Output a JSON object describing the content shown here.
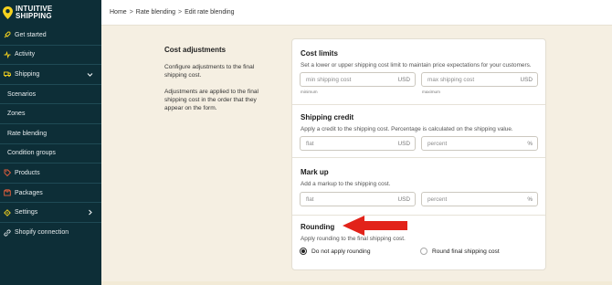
{
  "brand": {
    "line1": "INTUITIVE",
    "line2": "SHIPPING"
  },
  "sidebar": {
    "items": [
      {
        "label": "Get started",
        "icon": "rocket-icon"
      },
      {
        "label": "Activity",
        "icon": "activity-icon"
      },
      {
        "label": "Shipping",
        "icon": "truck-icon"
      },
      {
        "label": "Scenarios"
      },
      {
        "label": "Zones"
      },
      {
        "label": "Rate blending"
      },
      {
        "label": "Condition groups"
      },
      {
        "label": "Products",
        "icon": "tag-icon"
      },
      {
        "label": "Packages",
        "icon": "package-icon"
      },
      {
        "label": "Settings",
        "icon": "gear-icon"
      },
      {
        "label": "Shopify connection",
        "icon": "link-icon"
      }
    ]
  },
  "breadcrumb": {
    "home": "Home",
    "sep": ">",
    "rate_blending": "Rate blending",
    "current": "Edit rate blending"
  },
  "description": {
    "title": "Cost adjustments",
    "p1": "Configure adjustments to the final shipping cost.",
    "p2": "Adjustments are applied to the final shipping cost in the order that they appear on the form."
  },
  "cost_limits": {
    "title": "Cost limits",
    "help": "Set a lower or upper shipping cost limit to maintain price expectations for your customers.",
    "min_placeholder": "min shipping cost",
    "min_suffix": "USD",
    "min_caption": "minimum",
    "max_placeholder": "max shipping cost",
    "max_suffix": "USD",
    "max_caption": "maximum"
  },
  "shipping_credit": {
    "title": "Shipping credit",
    "help": "Apply a credit to the shipping cost. Percentage is calculated on the shipping value.",
    "flat_placeholder": "flat",
    "flat_suffix": "USD",
    "percent_placeholder": "percent",
    "percent_suffix": "%"
  },
  "mark_up": {
    "title": "Mark up",
    "help": "Add a markup to the shipping cost.",
    "flat_placeholder": "flat",
    "flat_suffix": "USD",
    "percent_placeholder": "percent",
    "percent_suffix": "%"
  },
  "rounding": {
    "title": "Rounding",
    "help": "Apply rounding to the final shipping cost.",
    "option1": "Do not apply rounding",
    "option2": "Round final shipping cost",
    "selected": "Do not apply rounding"
  },
  "colors": {
    "sidebar_bg": "#0d2e37",
    "page_bg": "#f5efe2",
    "accent_yellow": "#f5d31f",
    "arrow_red": "#e2231a"
  }
}
